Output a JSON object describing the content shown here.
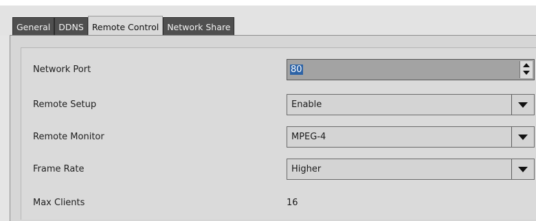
{
  "tabs": [
    {
      "label": "General",
      "active": false
    },
    {
      "label": "DDNS",
      "active": false
    },
    {
      "label": "Remote Control",
      "active": true
    },
    {
      "label": "Network Share",
      "active": false
    }
  ],
  "fields": {
    "network_port": {
      "label": "Network Port",
      "value": "80"
    },
    "remote_setup": {
      "label": "Remote Setup",
      "value": "Enable"
    },
    "remote_monitor": {
      "label": "Remote Monitor",
      "value": "MPEG-4"
    },
    "frame_rate": {
      "label": "Frame Rate",
      "value": "Higher"
    },
    "max_clients": {
      "label": "Max Clients",
      "value": "16"
    }
  },
  "icons": {
    "spinner": "spin-up-down-icon",
    "dropdown": "chevron-down-icon"
  }
}
